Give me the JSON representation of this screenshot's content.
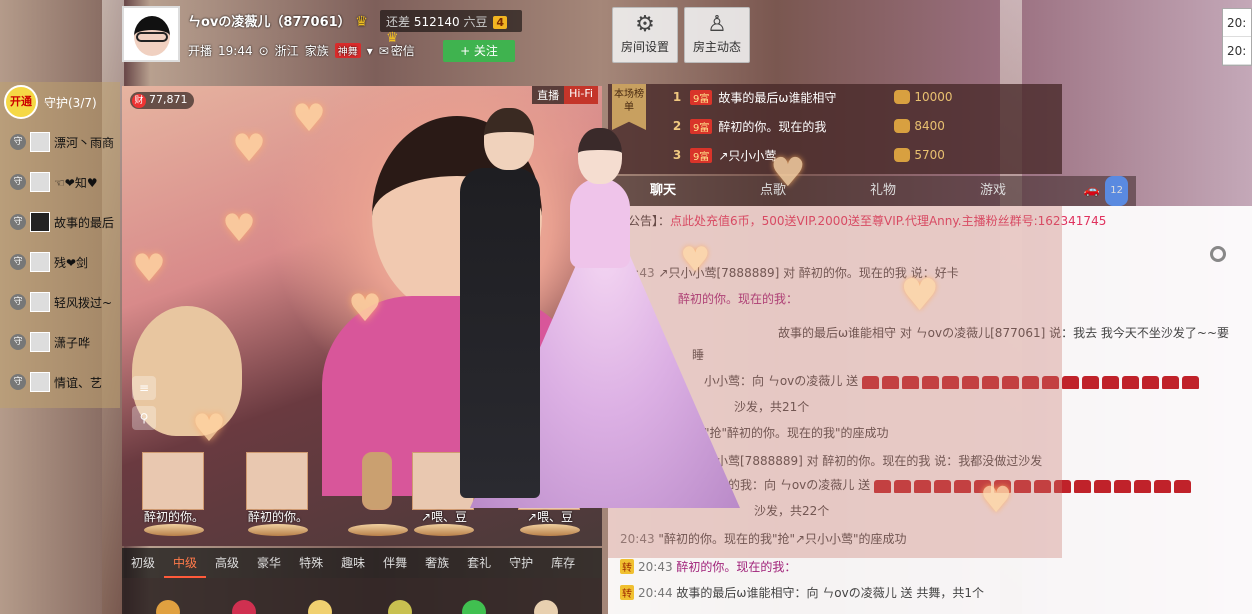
{
  "anchor": {
    "name": "ㄣovの凌薇儿（877061）",
    "diff_label": "还差",
    "diff_value": "512140",
    "diff_unit": "六豆",
    "level": "4",
    "live_label": "开播",
    "live_time": "19:44",
    "location": "浙江",
    "clan_label": "家族",
    "clan_badge": "神舞",
    "message_label": "密信",
    "follow_label": "+ 关注"
  },
  "top_buttons": {
    "room_settings": "房间设置",
    "host_news": "房主动态"
  },
  "corner_box": [
    "20:",
    "20:"
  ],
  "guard": {
    "open_label": "开通",
    "title": "守护(3/7)",
    "tag": "守",
    "items": [
      "漂河丶雨商",
      "☜❤知♥",
      "故事的最后",
      "残❤剑",
      "轻风拨过~",
      "潇子哗",
      "情谊、艺"
    ]
  },
  "video": {
    "coin_label": "财",
    "coin_count": "77,871",
    "tag_live": "直播",
    "tag_hifi": "Hi-Fi"
  },
  "seats": [
    {
      "label": "醉初的你。"
    },
    {
      "label": "醉初的你。"
    },
    {
      "label": "↗喂、豆"
    },
    {
      "label": "↗喂、豆"
    }
  ],
  "gift_tabs": [
    "初级",
    "中级",
    "高级",
    "豪华",
    "特殊",
    "趣味",
    "伴舞",
    "奢族",
    "套礼",
    "守护",
    "库存"
  ],
  "rank": {
    "flag": "本场榜单",
    "rows": [
      {
        "no": "1",
        "lv": "9富",
        "name": "故事的最后ω谁能相守",
        "value": "10000"
      },
      {
        "no": "2",
        "lv": "9富",
        "name": "醉初的你。现在的我",
        "value": "8400"
      },
      {
        "no": "3",
        "lv": "9富",
        "name": "↗只小小莺",
        "value": "5700"
      }
    ]
  },
  "chat": {
    "tabs": [
      "聊天",
      "点歌",
      "礼物",
      "游戏"
    ],
    "car_count": "12",
    "notice_prefix": "间公告】：",
    "notice_text": "点此处充值6币，500送VIP.2000送至尊VIP.代理Anny.主播粉丝群号:162341745",
    "lines": [
      {
        "time": "20:43",
        "text": "↗只小小莺[7888889] 对 醉初的你。现在的我 说：好卡"
      },
      {
        "time": "",
        "text": "醉初的你。现在的我："
      },
      {
        "time": "",
        "text": "故事的最后ω谁能相守 对 ㄣovの凌薇儿[877061] 说：我去  我今天不坐沙发了~~要"
      },
      {
        "time": "",
        "text": "睡"
      },
      {
        "time": "",
        "text": "小小莺：向 ㄣovの凌薇儿 送"
      },
      {
        "time": "",
        "text": "沙发，共21个"
      },
      {
        "time": "",
        "text": "\"抢\"醉初的你。现在的我\"的座成功"
      },
      {
        "time": "",
        "text": "小小莺[7888889] 对 醉初的你。现在的我 说：我都没做过沙发"
      },
      {
        "time": "",
        "text": "现在的我：向 ㄣovの凌薇儿 送"
      },
      {
        "time": "",
        "text": "沙发，共22个"
      },
      {
        "time": "20:43",
        "text": "\"醉初的你。现在的我\"抢\"↗只小小莺\"的座成功"
      },
      {
        "time": "20:43",
        "text": "醉初的你。现在的我："
      },
      {
        "time": "20:44",
        "text": "故事的最后ω谁能相守：向 ㄣovの凌薇儿 送"
      },
      {
        "time": "",
        "text": "共舞，共1个"
      }
    ],
    "zhuan": "转"
  }
}
